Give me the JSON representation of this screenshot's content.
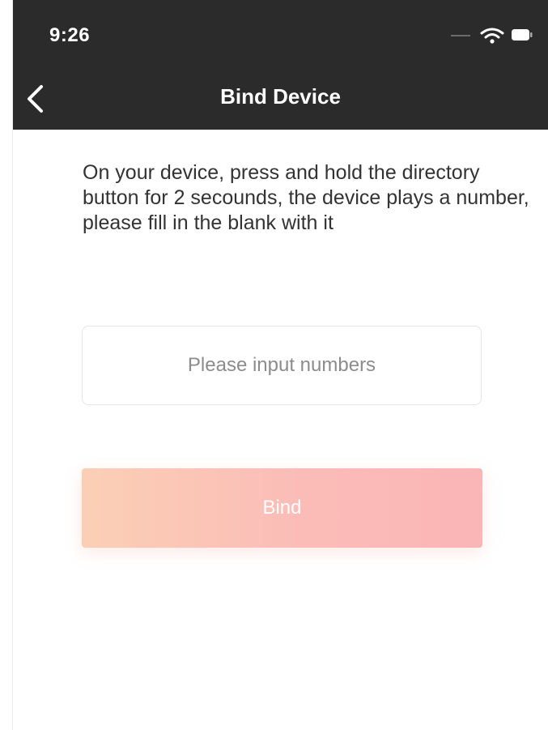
{
  "status_bar": {
    "time": "9:26",
    "icons": [
      "cellular-signal-icon",
      "wifi-icon",
      "battery-icon"
    ]
  },
  "nav": {
    "back_icon": "chevron-left-icon",
    "title": "Bind Device"
  },
  "main": {
    "instructions": "On your device, press and hold the directory button for 2 secounds, the device plays a number, please fill in the blank with it",
    "number_input": {
      "value": "",
      "placeholder": "Please input numbers"
    },
    "bind_button_label": "Bind"
  },
  "colors": {
    "header_background": "#2b2b2b",
    "button_gradient_start": "#fbcfb6",
    "button_gradient_end": "#fab5b6",
    "text_primary": "#333333",
    "placeholder_text": "#8c8c8c"
  }
}
